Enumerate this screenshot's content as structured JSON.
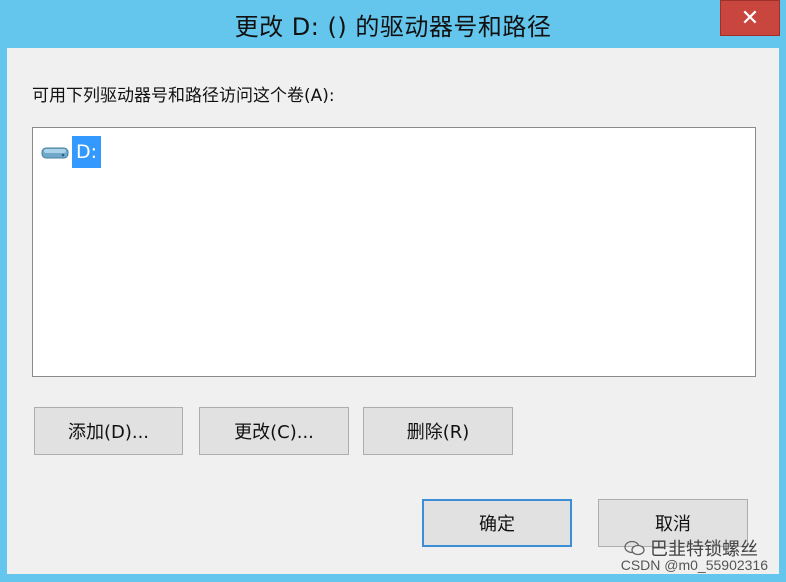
{
  "window": {
    "title": "更改 D: () 的驱动器号和路径",
    "close_glyph": "✕"
  },
  "prompt_label": "可用下列驱动器号和路径访问这个卷(A):",
  "list": {
    "items": [
      {
        "label": "D:",
        "icon": "drive-icon",
        "selected": true
      }
    ]
  },
  "buttons": {
    "add": "添加(D)...",
    "change": "更改(C)...",
    "remove": "删除(R)",
    "ok": "确定",
    "cancel": "取消"
  },
  "watermark": {
    "line1": "巴韭特锁螺丝",
    "line2": "CSDN @m0_55902316"
  },
  "colors": {
    "title_bar": "#64c6ec",
    "close_button": "#c9463e",
    "selection": "#3399ff",
    "dialog_background": "#f0f0f0"
  }
}
